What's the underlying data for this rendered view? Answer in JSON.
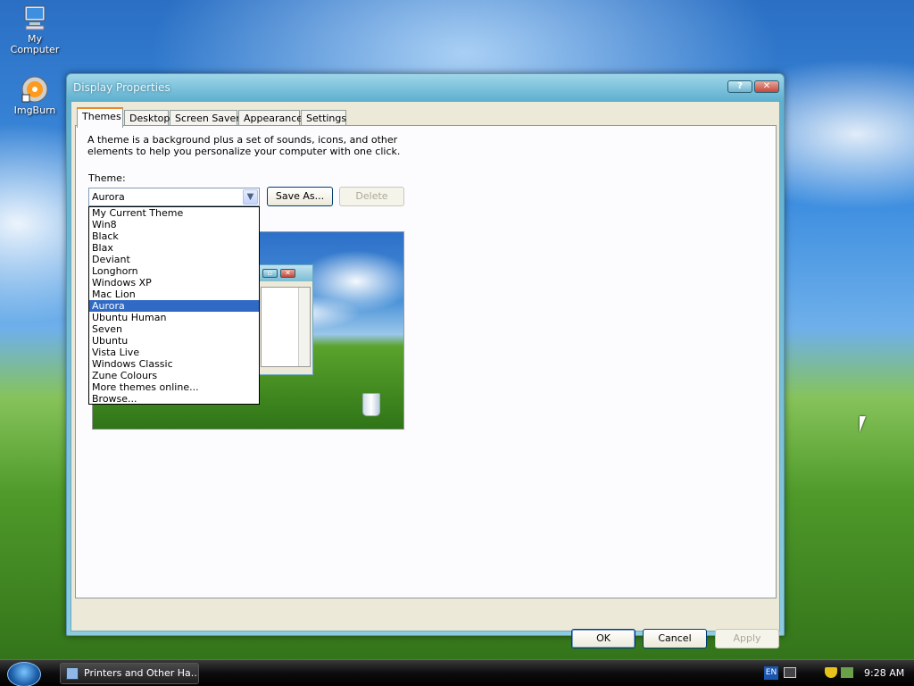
{
  "desktop": {
    "icons": [
      {
        "label": "My Computer",
        "icon": "computer-icon"
      },
      {
        "label": "ImgBurn",
        "icon": "imgburn-icon"
      }
    ]
  },
  "window": {
    "title": "Display Properties",
    "help_label": "?",
    "close_label": "✕",
    "tabs": [
      "Themes",
      "Desktop",
      "Screen Saver",
      "Appearance",
      "Settings"
    ],
    "active_tab": "Themes",
    "description": "A theme is a background plus a set of sounds, icons, and other elements to help you personalize your computer with one click.",
    "theme_label": "Theme:",
    "theme_value": "Aurora",
    "save_as_label": "Save As...",
    "delete_label": "Delete",
    "dropdown_options": [
      "My Current Theme",
      "Win8",
      "Black",
      "Blax",
      "Deviant",
      "Longhorn",
      "Windows XP",
      "Mac Lion",
      "Aurora",
      "Ubuntu Human",
      "Seven",
      "Ubuntu",
      "Vista Live",
      "Windows Classic",
      "Zune Colours",
      "More themes online...",
      "Browse..."
    ],
    "selected_option": "Aurora",
    "ok_label": "OK",
    "cancel_label": "Cancel",
    "apply_label": "Apply"
  },
  "taskbar": {
    "task_label": "Printers and Other Ha...",
    "language": "EN",
    "clock": "9:28 AM"
  },
  "colors": {
    "selection": "#316ac5",
    "tab_accent": "#e68b2c",
    "titlebar": "#5fb0cf"
  }
}
